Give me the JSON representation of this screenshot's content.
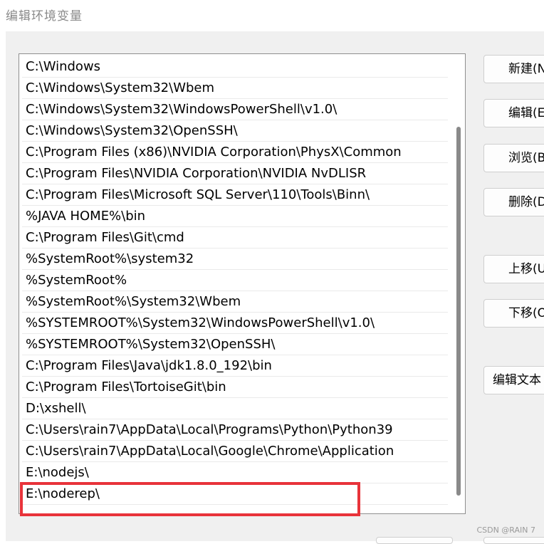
{
  "window": {
    "title": "编辑环境变量"
  },
  "paths": [
    "C:\\Windows",
    "C:\\Windows\\System32\\Wbem",
    "C:\\Windows\\System32\\WindowsPowerShell\\v1.0\\",
    "C:\\Windows\\System32\\OpenSSH\\",
    "C:\\Program Files (x86)\\NVIDIA Corporation\\PhysX\\Common",
    "C:\\Program Files\\NVIDIA Corporation\\NVIDIA NvDLISR",
    "C:\\Program Files\\Microsoft SQL Server\\110\\Tools\\Binn\\",
    "%JAVA HOME%\\bin",
    "C:\\Program Files\\Git\\cmd",
    "%SystemRoot%\\system32",
    "%SystemRoot%",
    "%SystemRoot%\\System32\\Wbem",
    "%SYSTEMROOT%\\System32\\WindowsPowerShell\\v1.0\\",
    "%SYSTEMROOT%\\System32\\OpenSSH\\",
    "C:\\Program Files\\Java\\jdk1.8.0_192\\bin",
    "C:\\Program Files\\TortoiseGit\\bin",
    "D:\\xshell\\",
    "C:\\Users\\rain7\\AppData\\Local\\Programs\\Python\\Python39",
    "C:\\Users\\rain7\\AppData\\Local\\Google\\Chrome\\Application",
    "E:\\nodejs\\",
    "E:\\noderep\\"
  ],
  "buttons": {
    "new": "新建(N",
    "edit": "编辑(E",
    "browse": "浏览(B",
    "delete": "删除(D",
    "move_up": "上移(U",
    "move_down": "下移(O",
    "edit_text": "编辑文本"
  },
  "watermark": "CSDN @RAIN 7",
  "colors": {
    "highlight": "#e8333a",
    "panel": "#f0f0f0"
  }
}
